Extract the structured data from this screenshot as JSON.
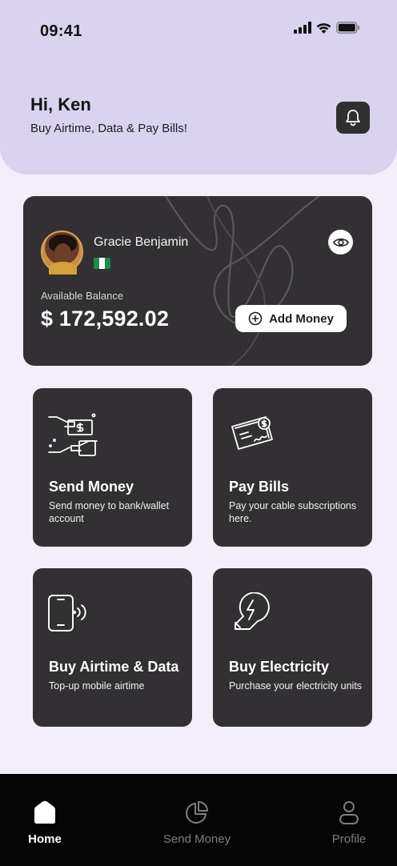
{
  "status_bar": {
    "time": "09:41"
  },
  "header": {
    "greeting": "Hi, Ken",
    "subtitle": "Buy Airtime, Data & Pay Bills!"
  },
  "balance_card": {
    "user_name": "Gracie Benjamin",
    "balance_label": "Available Balance",
    "balance_amount": "$ 172,592.02",
    "add_money_label": "Add Money",
    "flag_colors": [
      "#1f8a4c",
      "#ffffff",
      "#1f8a4c"
    ]
  },
  "services": [
    {
      "title": "Send Money",
      "description": "Send money to bank/wallet account",
      "icon": "money-transfer-icon"
    },
    {
      "title": "Pay Bills",
      "description": "Pay your cable subscriptions here.",
      "icon": "bills-icon"
    },
    {
      "title": "Buy Airtime & Data",
      "description": "Top-up mobile airtime",
      "icon": "phone-signal-icon"
    },
    {
      "title": "Buy Electricity",
      "description": "Purchase your electricity units",
      "icon": "lightbulb-icon"
    }
  ],
  "bottom_nav": {
    "items": [
      {
        "label": "Home",
        "icon": "home-icon",
        "active": true
      },
      {
        "label": "Send Money",
        "icon": "pie-chart-icon",
        "active": false
      },
      {
        "label": "Profile",
        "icon": "user-icon",
        "active": false
      }
    ]
  },
  "colors": {
    "header_bg": "#d9d3ef",
    "page_bg": "#f2eefb",
    "card_bg": "#323033",
    "nav_bg": "#050505",
    "nav_active": "#ffffff",
    "nav_inactive": "#7d7d7d"
  }
}
